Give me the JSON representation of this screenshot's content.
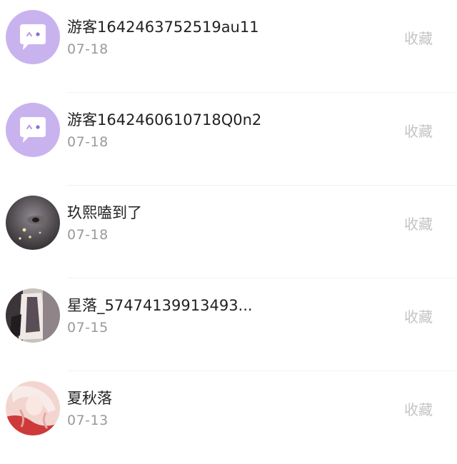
{
  "items": [
    {
      "name": "游客1642463752519au11",
      "date": "07-18",
      "action": "收藏",
      "avatar_icon": "chat-bubble-icon"
    },
    {
      "name": "游客1642460610718Q0n2",
      "date": "07-18",
      "action": "收藏",
      "avatar_icon": "chat-bubble-icon"
    },
    {
      "name": "玖熙嗑到了",
      "date": "07-18",
      "action": "收藏",
      "avatar_icon": "user-photo-icon"
    },
    {
      "name": "星落_57474139913493...",
      "date": "07-15",
      "action": "收藏",
      "avatar_icon": "user-photo-icon"
    },
    {
      "name": "夏秋落",
      "date": "07-13",
      "action": "收藏",
      "avatar_icon": "user-photo-icon"
    }
  ],
  "colors": {
    "default_avatar_bg": "#c9b3ee",
    "action_text": "#c4c4c4",
    "date_text": "#9a9a9a"
  }
}
